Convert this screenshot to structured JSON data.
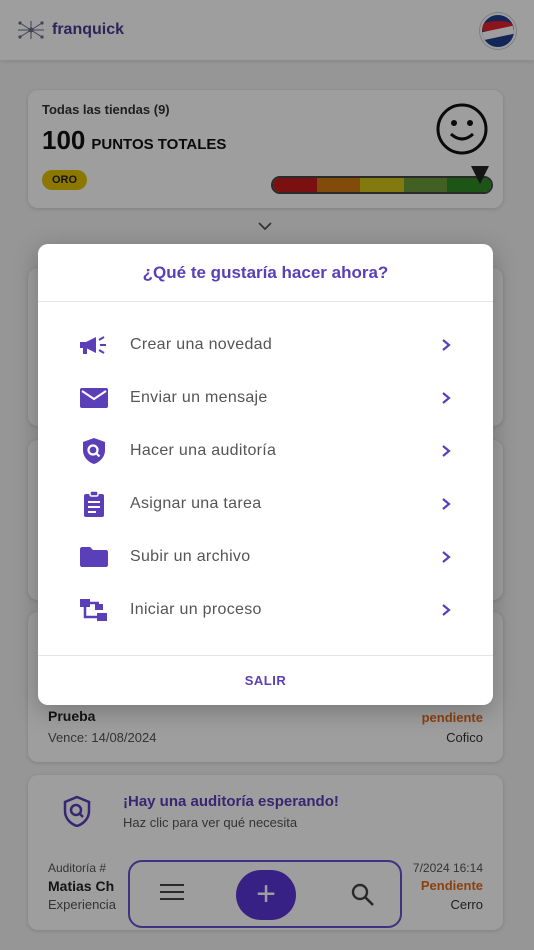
{
  "app": {
    "name": "franquick"
  },
  "summary": {
    "stores_label": "Todas las tiendas (9)",
    "points_value": "100",
    "points_label": "PUNTOS TOTALES",
    "tier": "ORO",
    "meter_colors": [
      "#c61b1b",
      "#d47a10",
      "#d2c419",
      "#6b9a3a",
      "#2e8a22"
    ]
  },
  "task_card": {
    "title": "Prueba",
    "due": "Vence: 14/08/2024",
    "status": "pendiente",
    "owner": "Cofico"
  },
  "audit_card": {
    "title": "¡Hay una auditoría esperando!",
    "subtitle": "Haz clic para ver qué necesita",
    "type": "Auditoría #",
    "name": "Matias Ch",
    "desc": "Experiencia",
    "date": "7/2024 16:14",
    "status": "Pendiente",
    "location": "Cerro"
  },
  "modal": {
    "title": "¿Qué te gustaría hacer ahora?",
    "options": [
      {
        "icon": "megaphone-icon",
        "label": "Crear una novedad"
      },
      {
        "icon": "envelope-icon",
        "label": "Enviar un mensaje"
      },
      {
        "icon": "shield-search-icon",
        "label": "Hacer una auditoría"
      },
      {
        "icon": "clipboard-icon",
        "label": "Asignar una tarea"
      },
      {
        "icon": "folder-icon",
        "label": "Subir un archivo"
      },
      {
        "icon": "process-tree-icon",
        "label": "Iniciar un proceso"
      }
    ],
    "exit_label": "SALIR"
  },
  "colors": {
    "accent": "#5a3fb8",
    "pending": "#e36a1c",
    "tier": "#e2c000"
  }
}
